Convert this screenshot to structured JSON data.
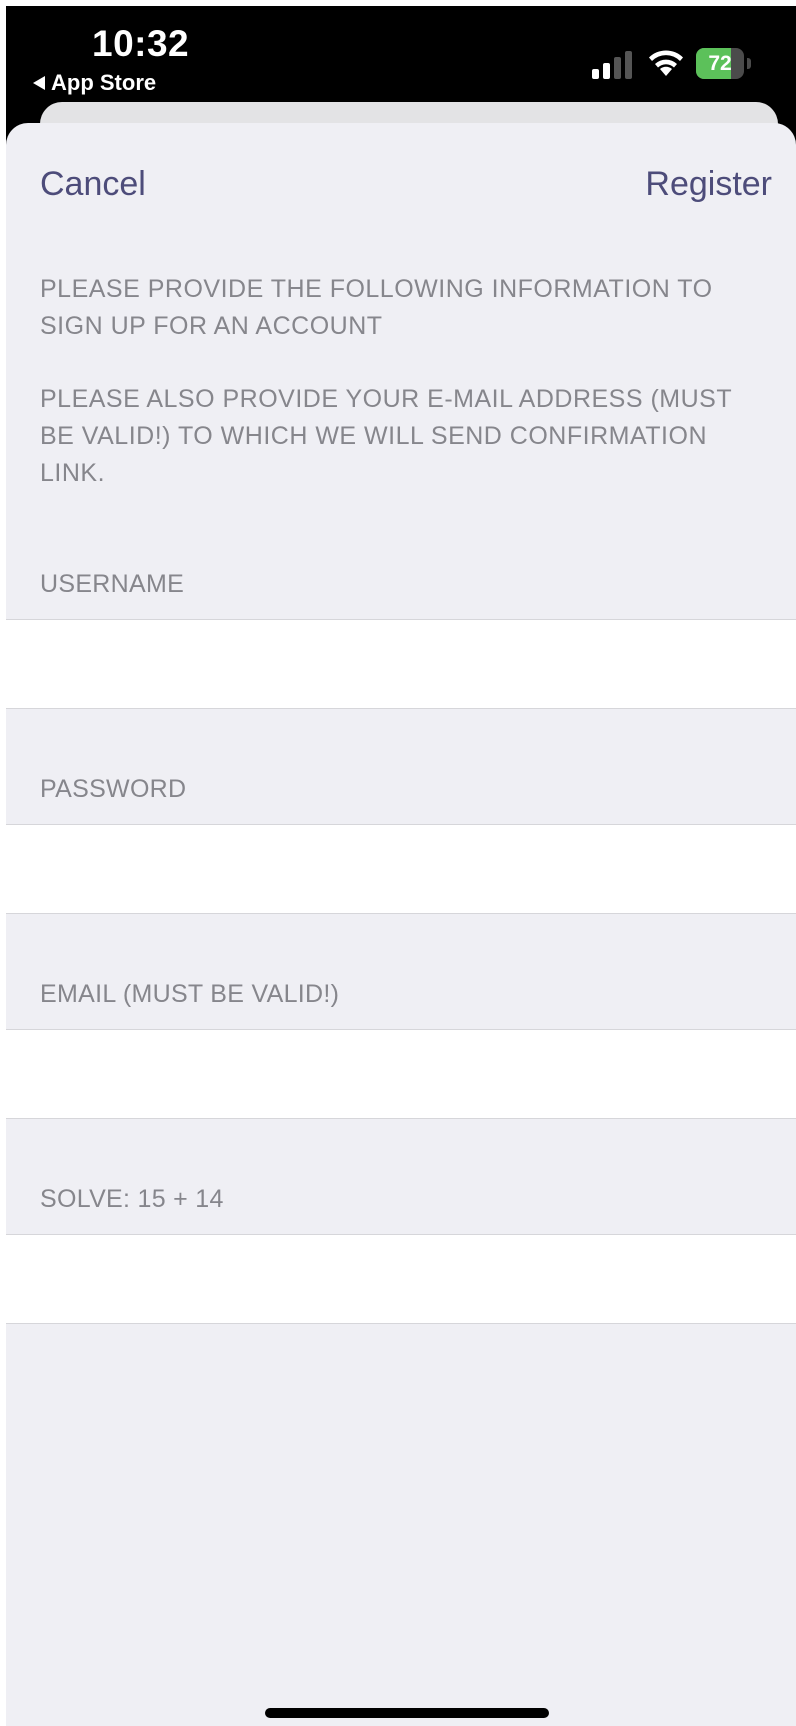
{
  "status_bar": {
    "time": "10:32",
    "back_label": "App Store",
    "battery": "72",
    "battery_level": 0.72,
    "icons": [
      "signal-icon",
      "wifi-icon",
      "battery-icon"
    ]
  },
  "nav": {
    "cancel_label": "Cancel",
    "register_label": "Register"
  },
  "info": {
    "line1": "PLEASE PROVIDE THE FOLLOWING INFORMATION TO SIGN UP FOR AN ACCOUNT",
    "line2": "PLEASE ALSO PROVIDE YOUR E-MAIL ADDRESS (MUST BE VALID!) TO WHICH WE WILL SEND CONFIRMATION LINK."
  },
  "form": {
    "username_label": "USERNAME",
    "username_value": "",
    "password_label": "PASSWORD",
    "password_value": "",
    "email_label": "EMAIL (MUST BE VALID!)",
    "email_value": "",
    "captcha_label": "SOLVE: 15 + 14",
    "captcha_value": ""
  },
  "colors": {
    "accent": "#4d4c7a",
    "background": "#efeff4",
    "label": "#86868c",
    "battery_green": "#5cc15a"
  }
}
